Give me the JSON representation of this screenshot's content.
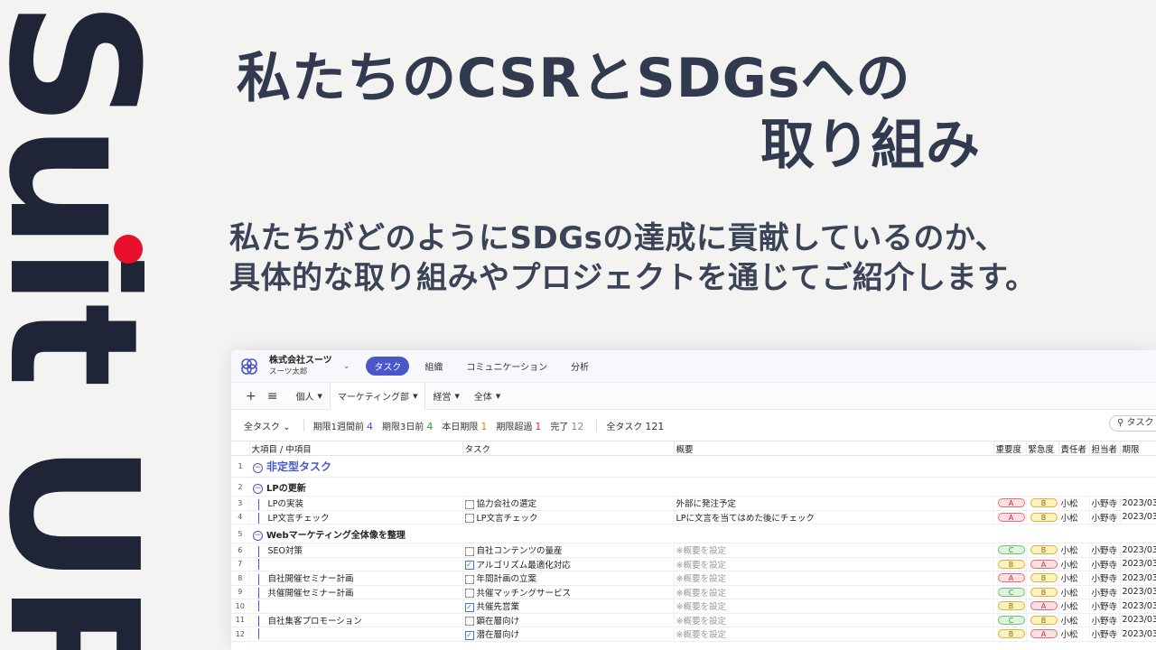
{
  "brand": {
    "name": "Suit UP"
  },
  "headline": {
    "line1": "私たちのCSRとSDGsへの",
    "line2": "取り組み"
  },
  "subtext": {
    "line1": "私たちがどのようにSDGsの達成に貢献しているのか、",
    "line2": "具体的な取り組みやプロジェクトを通じてご紹介します。"
  },
  "app": {
    "company": "株式会社スーツ",
    "user": "スーツ太郎",
    "nav": [
      "タスク",
      "組織",
      "コミュニケーション",
      "分析"
    ],
    "views": [
      "個人",
      "マーケティング部",
      "経営",
      "全体"
    ],
    "filters": {
      "all_dropdown": "全タスク",
      "week_label": "期限1週間前",
      "week_count": "4",
      "three_label": "期限3日前",
      "three_count": "4",
      "today_label": "本日期限",
      "today_count": "1",
      "over_label": "期限超過",
      "over_count": "1",
      "done_label": "完了",
      "done_count": "12",
      "total_label": "全タスク",
      "total_count": "121"
    },
    "search_label": "タスク",
    "columns": [
      "大項目 / 中項目",
      "タスク",
      "概要",
      "重要度",
      "緊急度",
      "責任者",
      "担当者",
      "期限"
    ],
    "rows": [
      {
        "n": "1",
        "kind": "grp1",
        "label": "非定型タスク"
      },
      {
        "n": "2",
        "kind": "grp2",
        "label": "LPの更新"
      },
      {
        "n": "3",
        "kind": "task",
        "item": "LPの実装",
        "task": "協力会社の選定",
        "done": false,
        "summary": "外部に発注予定",
        "ph": false,
        "imp": "A",
        "urg": "B",
        "owner": "小松",
        "assignee": "小野寺",
        "due": "2023/03"
      },
      {
        "n": "4",
        "kind": "task",
        "item": "LP文言チェック",
        "task": "LP文言チェック",
        "done": false,
        "summary": "LPに文言を当てはめた後にチェック",
        "ph": false,
        "imp": "A",
        "urg": "B",
        "owner": "小松",
        "assignee": "小野寺",
        "due": "2023/03"
      },
      {
        "n": "5",
        "kind": "grp2",
        "label": "Webマーケティング全体像を整理"
      },
      {
        "n": "6",
        "kind": "task",
        "item": "SEO対策",
        "task": "自社コンテンツの量産",
        "done": false,
        "summary": "※概要を設定",
        "ph": true,
        "imp": "C",
        "urg": "B",
        "owner": "小松",
        "assignee": "小野寺",
        "due": "2023/03"
      },
      {
        "n": "7",
        "kind": "task",
        "item": "",
        "task": "アルゴリズム最適化対応",
        "done": true,
        "summary": "※概要を設定",
        "ph": true,
        "imp": "B",
        "urg": "A",
        "owner": "小松",
        "assignee": "小野寺",
        "due": "2023/03"
      },
      {
        "n": "8",
        "kind": "task",
        "item": "自社開催セミナー計画",
        "task": "年間計画の立案",
        "done": false,
        "summary": "※概要を設定",
        "ph": true,
        "imp": "A",
        "urg": "B",
        "owner": "小松",
        "assignee": "小野寺",
        "due": "2023/03"
      },
      {
        "n": "9",
        "kind": "task",
        "item": "共催開催セミナー計画",
        "task": "共催マッチングサービス",
        "done": false,
        "summary": "※概要を設定",
        "ph": true,
        "imp": "C",
        "urg": "B",
        "owner": "小松",
        "assignee": "小野寺",
        "due": "2023/03"
      },
      {
        "n": "10",
        "kind": "task",
        "item": "",
        "task": "共催先営業",
        "done": true,
        "summary": "※概要を設定",
        "ph": true,
        "imp": "B",
        "urg": "A",
        "owner": "小松",
        "assignee": "小野寺",
        "due": "2023/03"
      },
      {
        "n": "11",
        "kind": "task",
        "item": "自社集客プロモーション",
        "task": "顕在層向け",
        "done": false,
        "summary": "※概要を設定",
        "ph": true,
        "imp": "C",
        "urg": "B",
        "owner": "小松",
        "assignee": "小野寺",
        "due": "2023/03"
      },
      {
        "n": "12",
        "kind": "task",
        "item": "",
        "task": "潜在層向け",
        "done": true,
        "summary": "※概要を設定",
        "ph": true,
        "imp": "B",
        "urg": "A",
        "owner": "小松",
        "assignee": "小野寺",
        "due": "2023/03"
      }
    ]
  }
}
